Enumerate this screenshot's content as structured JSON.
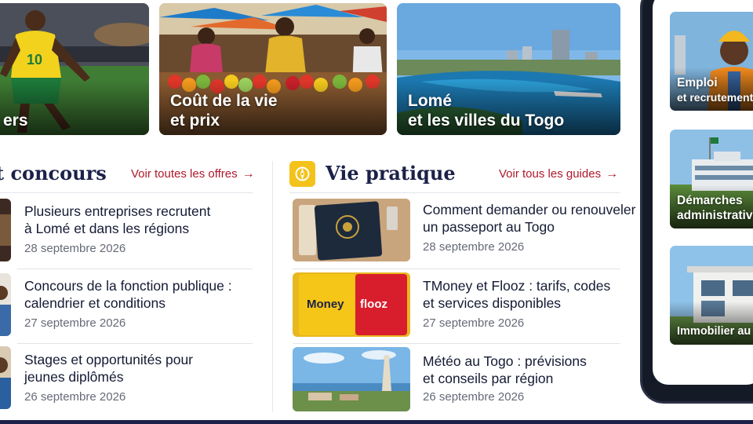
{
  "top_cards": [
    {
      "line1": "",
      "line2": "ers"
    },
    {
      "line1": "Coût de la vie",
      "line2": "et prix"
    },
    {
      "line1": "Lomé",
      "line2": "et les villes du Togo"
    }
  ],
  "left_section": {
    "title": "t concours",
    "link_label": "Voir toutes les offres",
    "link_arrow": "→",
    "articles": [
      {
        "line1": "Plusieurs entreprises recrutent",
        "line2": "à Lomé et dans les régions",
        "date": "28 septembre 2026"
      },
      {
        "line1": "Concours de la fonction publique :",
        "line2": "calendrier et conditions",
        "date": "27 septembre 2026"
      },
      {
        "line1": "Stages et opportunités pour",
        "line2": "jeunes diplômés",
        "date": "26 septembre 2026"
      }
    ]
  },
  "right_section": {
    "title": "Vie pratique",
    "icon": "compass-icon",
    "link_label": "Voir tous les guides",
    "link_arrow": "→",
    "articles": [
      {
        "line1": "Comment demander ou renouveler",
        "line2": "un passeport au Togo",
        "date": "28 septembre 2026"
      },
      {
        "line1": "TMoney et Flooz : tarifs, codes",
        "line2": "et services disponibles",
        "date": "27 septembre 2026"
      },
      {
        "line1": "Météo au Togo : prévisions",
        "line2": "et conseils par région",
        "date": "26 septembre 2026"
      }
    ]
  },
  "thumb_labels": {
    "tmoney": "Money",
    "flooz": "flooz"
  },
  "phone": {
    "cards": [
      {
        "line1": "Emploi",
        "line2": "et recrutement"
      },
      {
        "line1": "Démarches",
        "line2": "administratives"
      },
      {
        "line1": "Immobilier au To",
        "line2": ""
      }
    ]
  },
  "colors": {
    "accent_red": "#b0182b",
    "title_navy": "#1b2148",
    "icon_yellow": "#f3c21b"
  }
}
